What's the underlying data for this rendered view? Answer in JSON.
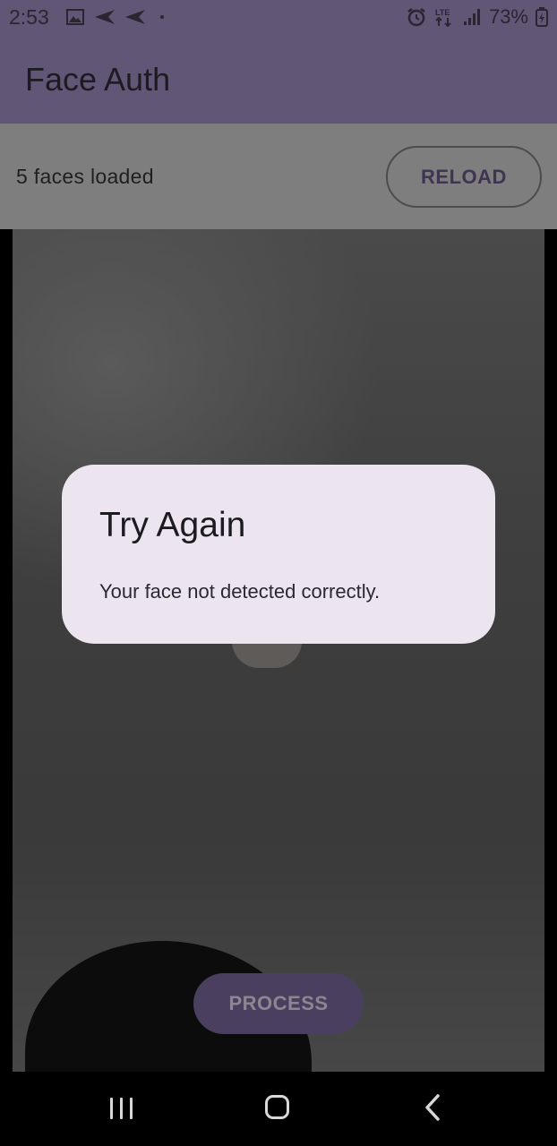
{
  "status_bar": {
    "time": "2:53",
    "battery": "73%",
    "network": "LTE"
  },
  "app_bar": {
    "title": "Face Auth"
  },
  "info": {
    "faces_loaded": "5 faces loaded",
    "reload_label": "RELOAD"
  },
  "dialog": {
    "title": "Try Again",
    "message": "Your face not detected correctly."
  },
  "actions": {
    "process_label": "PROCESS"
  },
  "colors": {
    "app_bar": "#625677",
    "dialog_bg": "#ece4ee",
    "process_button": "#4b3f5f"
  }
}
